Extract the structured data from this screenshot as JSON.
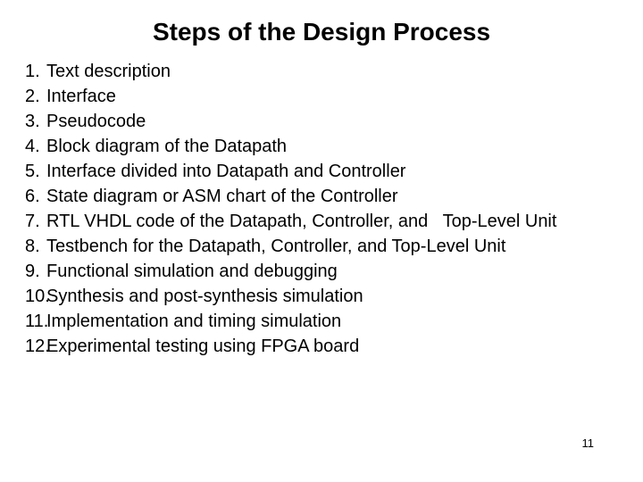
{
  "slide": {
    "title": "Steps of the Design Process",
    "page_number": "11",
    "background_color": "#ffffff",
    "text_color": "#000000",
    "items": [
      {
        "number": "1.",
        "text": "Text description"
      },
      {
        "number": "2.",
        "text": "Interface"
      },
      {
        "number": "3.",
        "text": "Pseudocode"
      },
      {
        "number": "4.",
        "text": "Block diagram of the Datapath"
      },
      {
        "number": "5.",
        "text": "Interface divided into Datapath and Controller"
      },
      {
        "number": "6.",
        "text": "State diagram or ASM chart of the Controller"
      },
      {
        "number": "7.",
        "text": "RTL VHDL code of the Datapath, Controller, and   Top-Level Unit"
      },
      {
        "number": "8.",
        "text": "Testbench for the Datapath, Controller, and Top-Level Unit"
      },
      {
        "number": "9.",
        "text": "Functional simulation and debugging"
      },
      {
        "number": "10.",
        "text": "Synthesis and post-synthesis simulation"
      },
      {
        "number": "11.",
        "text": "Implementation and timing simulation"
      },
      {
        "number": "12.",
        "text": "Experimental testing using FPGA board"
      }
    ]
  }
}
